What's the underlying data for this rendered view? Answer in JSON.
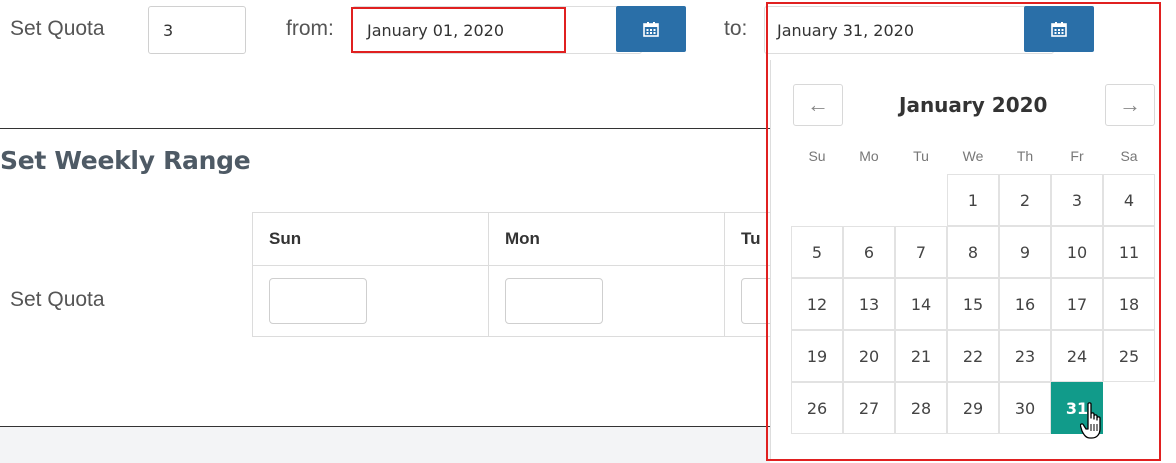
{
  "quota": {
    "label": "Set Quota",
    "value": "3"
  },
  "from": {
    "label": "from:",
    "value": "January 01, 2020"
  },
  "to": {
    "label": "to:",
    "value": "January 31, 2020"
  },
  "weekly": {
    "title": "Set Weekly Range",
    "row_label": "Set Quota",
    "columns": [
      "Sun",
      "Mon",
      "Tu"
    ]
  },
  "calendar": {
    "month_label": "January 2020",
    "prev_icon": "←",
    "next_icon": "→",
    "weekdays": [
      "Su",
      "Mo",
      "Tu",
      "We",
      "Th",
      "Fr",
      "Sa"
    ],
    "weeks": [
      [
        "",
        "",
        "",
        "1",
        "2",
        "3",
        "4"
      ],
      [
        "5",
        "6",
        "7",
        "8",
        "9",
        "10",
        "11"
      ],
      [
        "12",
        "13",
        "14",
        "15",
        "16",
        "17",
        "18"
      ],
      [
        "19",
        "20",
        "21",
        "22",
        "23",
        "24",
        "25"
      ],
      [
        "26",
        "27",
        "28",
        "29",
        "30",
        "31",
        ""
      ]
    ],
    "selected_day": "31"
  },
  "colors": {
    "calendar_button": "#2a6fa8",
    "selected_day": "#119b8a",
    "highlight_border": "#e02020"
  },
  "icons": {
    "calendar": "calendar-icon",
    "cursor": "hand-pointer-icon"
  }
}
